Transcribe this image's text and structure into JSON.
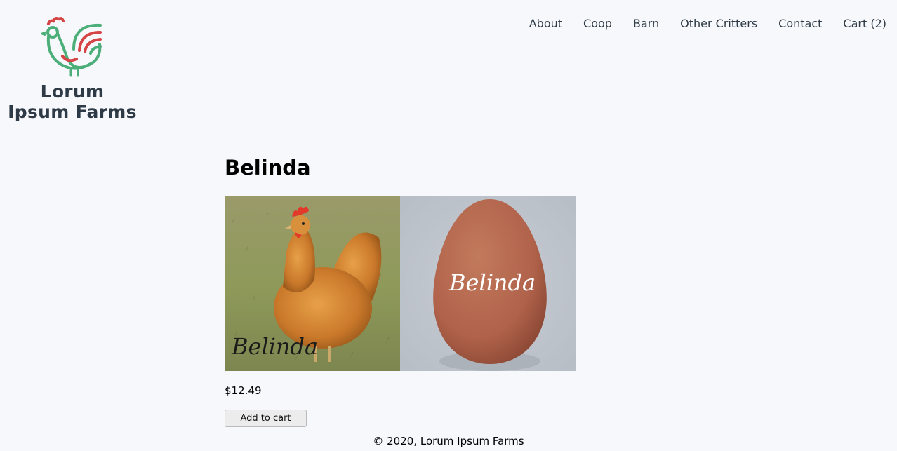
{
  "brand": {
    "name_line1": "Lorum",
    "name_line2": "Ipsum Farms",
    "logo_icon": "rooster-icon"
  },
  "nav": {
    "items": [
      {
        "label": "About"
      },
      {
        "label": "Coop"
      },
      {
        "label": "Barn"
      },
      {
        "label": "Other Critters"
      },
      {
        "label": "Contact"
      },
      {
        "label": "Cart (2)"
      }
    ]
  },
  "product": {
    "title": "Belinda",
    "price": "$12.49",
    "add_to_cart_label": "Add to cart",
    "images": [
      {
        "alt": "hen",
        "caption": "Belinda"
      },
      {
        "alt": "egg",
        "caption": "Belinda"
      }
    ]
  },
  "footer": {
    "text": "© 2020, Lorum Ipsum Farms"
  },
  "colors": {
    "background": "#f7f8fc",
    "logo_green": "#4caf7a",
    "logo_red": "#d64545",
    "text_dark": "#2e3b46"
  }
}
